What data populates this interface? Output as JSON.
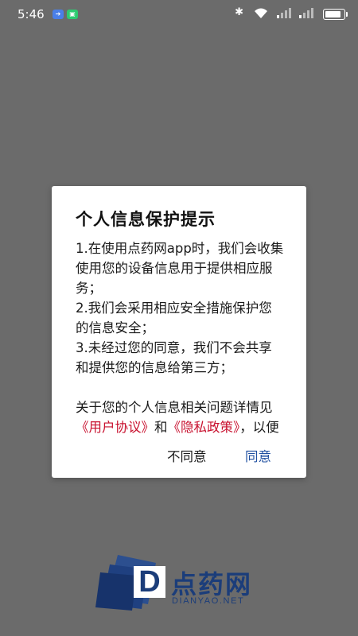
{
  "status_bar": {
    "time": "5:46",
    "icons": [
      "notification-arrow-icon",
      "notification-app-icon",
      "bluetooth-icon",
      "wifi-icon",
      "signal-icon",
      "signal-icon",
      "battery-icon"
    ]
  },
  "dialog": {
    "title": "个人信息保护提示",
    "items": [
      "1.在使用点药网app时，我们会收集使用您的设备信息用于提供相应服务；",
      "2.我们会采用相应安全措施保护您的信息安全；",
      "3.未经过您的同意，我们不会共享和提供您的信息给第三方；"
    ],
    "details_prefix": "关于您的个人信息相关问题详情见",
    "user_agreement_link": "《用户协议》",
    "details_and": "和",
    "privacy_policy_link": "《隐私政策》",
    "details_suffix": "，以便了解我们收集、使用",
    "disagree_button": "不同意",
    "agree_button": "同意"
  },
  "brand": {
    "logo_letter": "D",
    "name_cn": "点药网",
    "name_en": "DIANYAO.NET",
    "color": "#1b3d7a"
  }
}
